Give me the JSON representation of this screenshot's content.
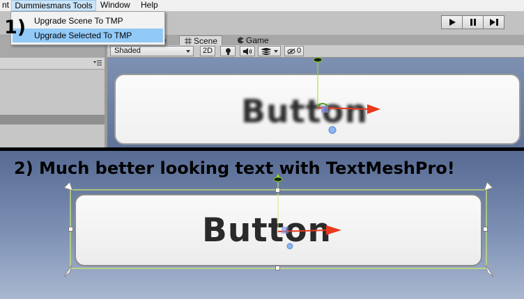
{
  "menubar": {
    "edge_item": "nt",
    "dummies_menu": "Dummiesmans Tools",
    "window_menu": "Window",
    "help_menu": "Help"
  },
  "dropdown": {
    "items": [
      "Upgrade Scene To TMP",
      "Upgrade Selected To TMP"
    ],
    "highlighted_index": 1
  },
  "tabs": {
    "partial": "e",
    "scene": "Scene",
    "game": "Game"
  },
  "scene_toolbar": {
    "shading": "Shaded",
    "mode_2d": "2D",
    "hidden_count": "0"
  },
  "annotations": {
    "step1": "1)",
    "step2": "2) Much better looking text with TextMeshPro!"
  },
  "buttons": {
    "before_label": "Button",
    "after_label": "Button"
  },
  "icons": {
    "play": "play-icon",
    "pause": "pause-icon",
    "step": "step-icon",
    "scene": "scene-grid-icon",
    "game": "game-pacman-icon",
    "lighting": "lightbulb-icon",
    "audio": "speaker-icon",
    "effects": "effects-icon",
    "visibility": "eye-off-icon",
    "move_gizmo": "move-gizmo-icon"
  },
  "colors": {
    "dropdown_highlight": "#91c9f7",
    "menu_active": "#cce4f7",
    "scene_bg": "#6f83a8",
    "gizmo_y": "#9be21f",
    "gizmo_x": "#e8391c",
    "rect_outline": "#d8ef5a"
  }
}
